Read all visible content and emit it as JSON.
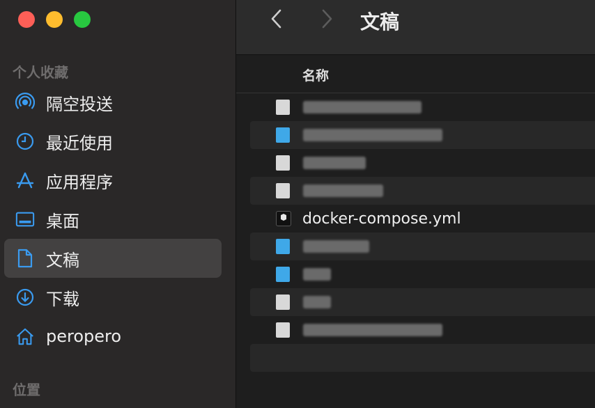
{
  "window": {
    "title": "文稿"
  },
  "sidebar": {
    "favorites_title": "个人收藏",
    "locations_title": "位置",
    "items": [
      {
        "label": "隔空投送",
        "icon": "airdrop-icon"
      },
      {
        "label": "最近使用",
        "icon": "clock-icon"
      },
      {
        "label": "应用程序",
        "icon": "applications-icon"
      },
      {
        "label": "桌面",
        "icon": "desktop-icon"
      },
      {
        "label": "文稿",
        "icon": "document-icon",
        "selected": true
      },
      {
        "label": "下载",
        "icon": "download-icon"
      },
      {
        "label": "peropero",
        "icon": "home-icon"
      }
    ]
  },
  "list": {
    "column_name": "名称",
    "visible_file": "docker-compose.yml"
  },
  "colors": {
    "accent": "#3a9bf0",
    "selection": "#434141"
  }
}
